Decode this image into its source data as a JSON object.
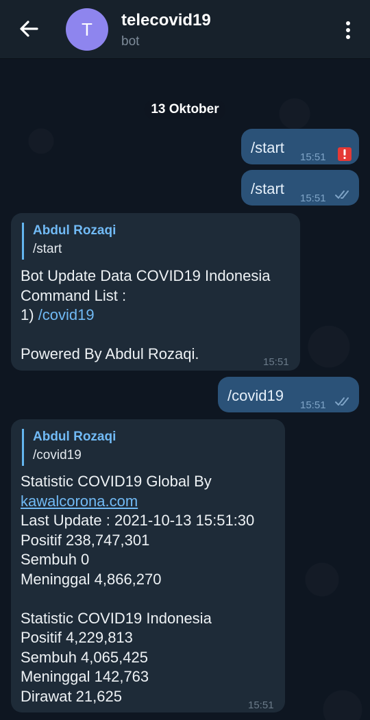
{
  "header": {
    "avatar_letter": "T",
    "title": "telecovid19",
    "subtitle": "bot",
    "avatar_color": "#8e85ee"
  },
  "date_separator": "13 Oktober",
  "messages": [
    {
      "id": "m1",
      "direction": "out",
      "text": "/start",
      "time": "15:51",
      "status": "error",
      "status_icon": "error-icon"
    },
    {
      "id": "m2",
      "direction": "out",
      "text": "/start",
      "time": "15:51",
      "status": "read",
      "status_icon": "double-check-icon"
    },
    {
      "id": "m3",
      "direction": "in",
      "reply": {
        "name": "Abdul Rozaqi",
        "text": "/start"
      },
      "lines": [
        "Bot Update Data COVID19 Indonesia",
        "Command List :",
        "1) ",
        "",
        "Powered By Abdul Rozaqi."
      ],
      "command_link": "/covid19",
      "time": "15:51"
    },
    {
      "id": "m4",
      "direction": "out",
      "text": "/covid19",
      "time": "15:51",
      "status": "read",
      "status_icon": "double-check-icon"
    },
    {
      "id": "m5",
      "direction": "in",
      "reply": {
        "name": "Abdul Rozaqi",
        "text": "/covid19"
      },
      "lines": [
        "Statistic COVID19 Global By",
        "kawalcorona.com",
        "Last Update : 2021-10-13 15:51:30",
        "Positif 238,747,301",
        "Sembuh 0",
        "Meninggal 4,866,270",
        "",
        "Statistic COVID19 Indonesia",
        "Positif 4,229,813",
        "Sembuh 4,065,425",
        "Meninggal 142,763",
        "Dirawat 21,625"
      ],
      "time": "15:51"
    }
  ],
  "colors": {
    "chat_background": "#0e1621",
    "header_background": "#17212b",
    "outgoing_bubble": "#2b5278",
    "incoming_bubble": "#1e2b38",
    "link": "#71baf5",
    "error": "#e53935"
  }
}
